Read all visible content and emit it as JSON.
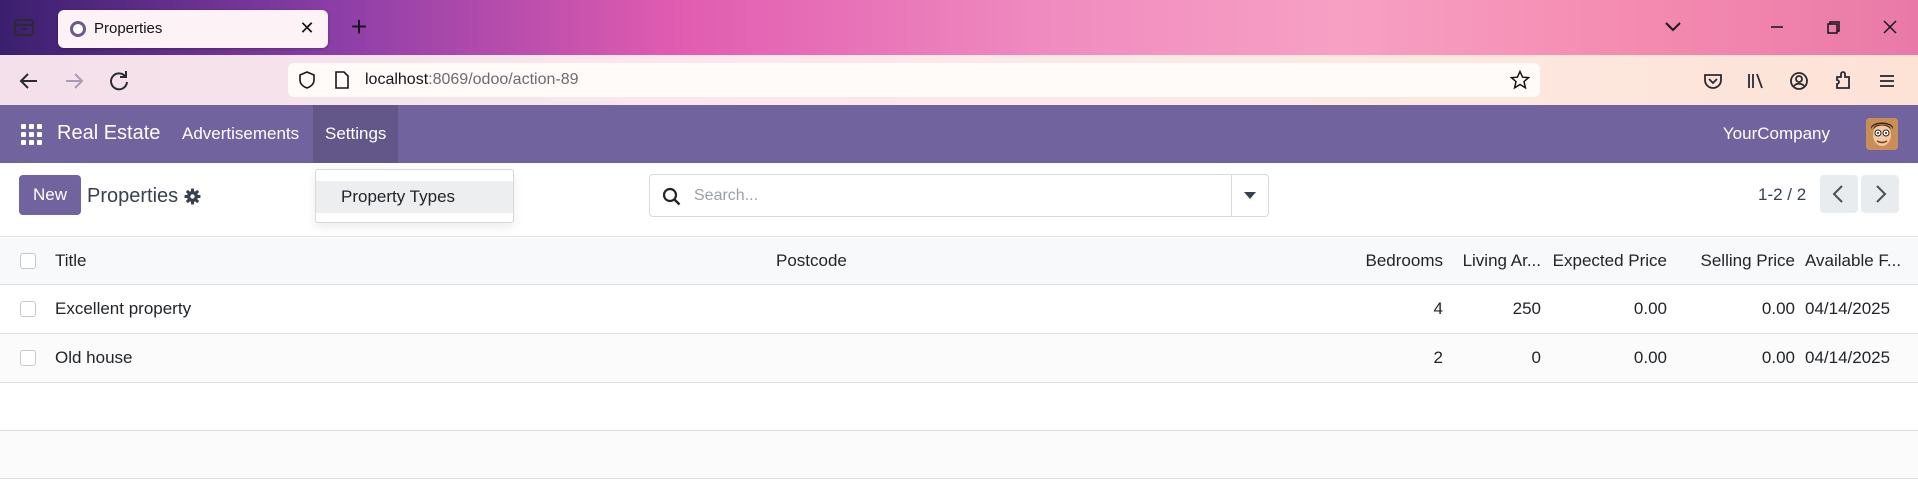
{
  "browser": {
    "tab_title": "Properties",
    "url_host": "localhost",
    "url_path": ":8069/odoo/action-89"
  },
  "app": {
    "brand": "Real Estate",
    "menu": [
      "Advertisements",
      "Settings"
    ],
    "active_menu": "Settings",
    "company": "YourCompany"
  },
  "control_panel": {
    "new_label": "New",
    "breadcrumb": "Properties",
    "search_placeholder": "Search...",
    "pager": "1-2 / 2"
  },
  "settings_dropdown": {
    "items": [
      "Property Types"
    ]
  },
  "list": {
    "columns": [
      "Title",
      "Postcode",
      "Bedrooms",
      "Living Ar...",
      "Expected Price",
      "Selling Price",
      "Available F..."
    ],
    "rows": [
      {
        "title": "Excellent property",
        "postcode": "",
        "bedrooms": "4",
        "living_area": "250",
        "expected_price": "0.00",
        "selling_price": "0.00",
        "available_from": "04/14/2025"
      },
      {
        "title": "Old house",
        "postcode": "",
        "bedrooms": "2",
        "living_area": "0",
        "expected_price": "0.00",
        "selling_price": "0.00",
        "available_from": "04/14/2025"
      }
    ]
  },
  "colors": {
    "odoo_primary": "#71639e",
    "border": "#dee2e6"
  }
}
